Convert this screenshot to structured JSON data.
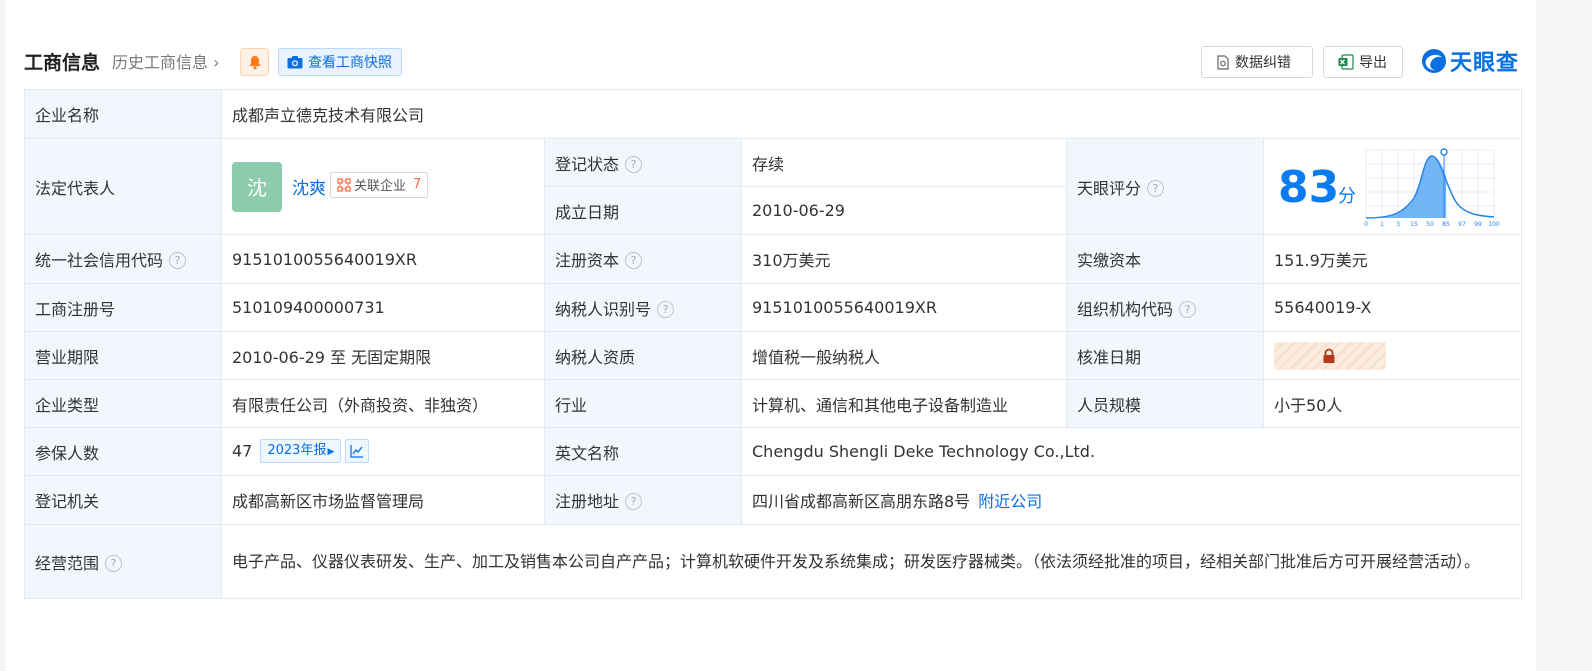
{
  "header": {
    "title": "工商信息",
    "history_link": "历史工商信息",
    "snapshot_btn": "查看工商快照",
    "fix_btn": "数据纠错",
    "export_btn": "导出",
    "logo_text": "天眼查"
  },
  "labels": {
    "company_name": "企业名称",
    "legal_rep": "法定代表人",
    "reg_status": "登记状态",
    "found_date": "成立日期",
    "tianyan_score": "天眼评分",
    "credit_code": "统一社会信用代码",
    "reg_capital": "注册资本",
    "paid_capital": "实缴资本",
    "reg_no": "工商注册号",
    "taxpayer_id": "纳税人识别号",
    "org_code": "组织机构代码",
    "business_term": "营业期限",
    "taxpayer_qual": "纳税人资质",
    "approval_date": "核准日期",
    "company_type": "企业类型",
    "industry": "行业",
    "staff_size": "人员规模",
    "insured": "参保人数",
    "english_name": "英文名称",
    "reg_authority": "登记机关",
    "reg_address": "注册地址",
    "business_scope": "经营范围"
  },
  "values": {
    "company_name": "成都声立德克技术有限公司",
    "rep_avatar": "沈",
    "rep_name": "沈爽",
    "rel_label": "关联企业",
    "rel_count": "7",
    "reg_status": "存续",
    "found_date": "2010-06-29",
    "score": "83",
    "score_unit": "分",
    "credit_code": "9151010055640019XR",
    "reg_capital": "310万美元",
    "paid_capital": "151.9万美元",
    "reg_no": "510109400000731",
    "taxpayer_id": "9151010055640019XR",
    "org_code": "55640019-X",
    "business_term": "2010-06-29 至 无固定期限",
    "taxpayer_qual": "增值税一般纳税人",
    "company_type": "有限责任公司（外商投资、非独资）",
    "industry": "计算机、通信和其他电子设备制造业",
    "staff_size": "小于50人",
    "insured": "47",
    "insured_year": "2023年报",
    "english_name": "Chengdu Shengli Deke Technology Co.,Ltd.",
    "reg_authority": "成都高新区市场监督管理局",
    "reg_address": "四川省成都高新区高朋东路8号",
    "nearby_link": "附近公司",
    "business_scope": "电子产品、仪器仪表研发、生产、加工及销售本公司自产产品；计算机软硬件开发及系统集成；研发医疗器械类。（依法须经批准的项目，经相关部门批准后方可开展经营活动）。"
  },
  "score_chart_ticks": [
    "0",
    "1",
    "3",
    "15",
    "50",
    "85",
    "97",
    "99",
    "100"
  ],
  "colors": {
    "accent": "#0a6fe0",
    "status_green": "#1a9b4b",
    "label_bg": "#f2f7fd",
    "avatar_bg": "#8ccbab"
  }
}
